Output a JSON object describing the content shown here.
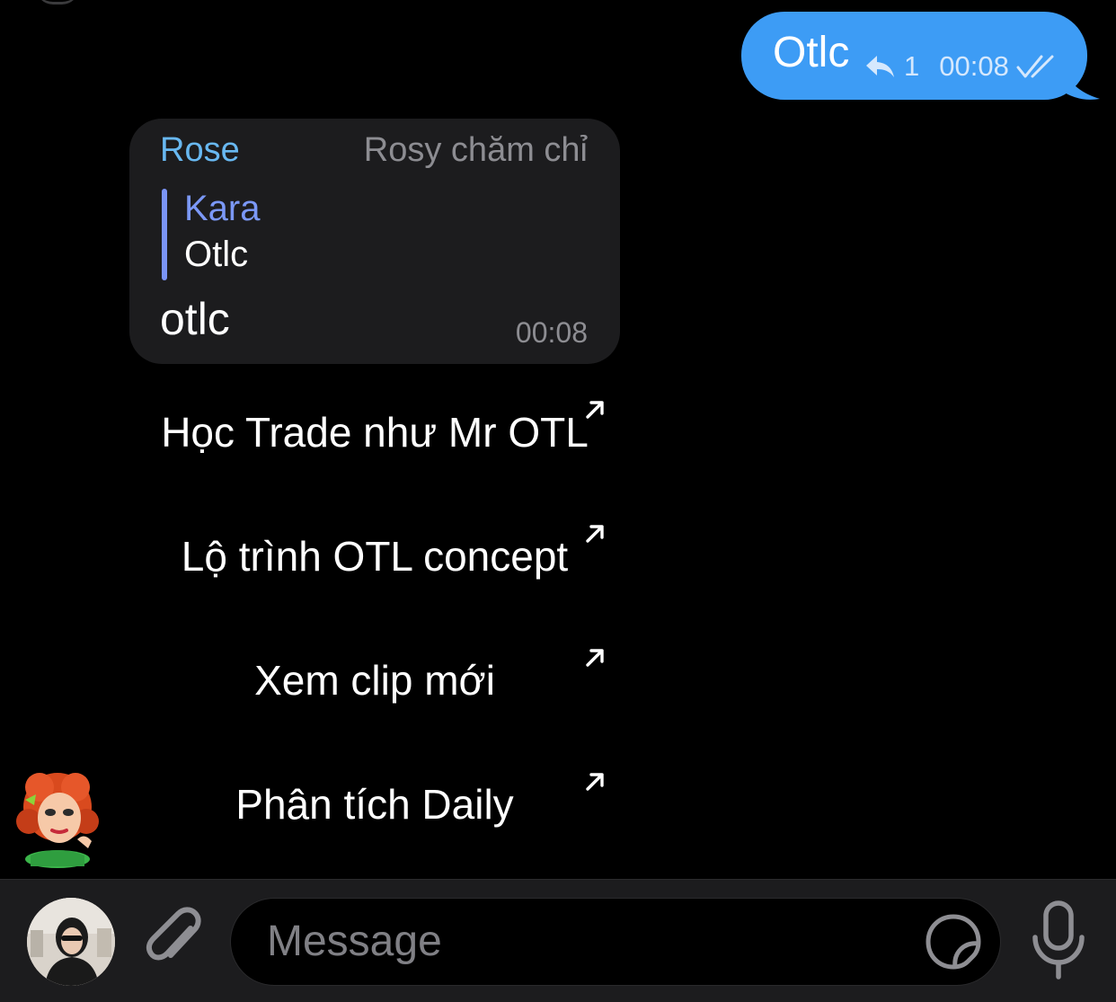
{
  "outgoing": {
    "text": "Otlc",
    "reply_count": "1",
    "time": "00:08",
    "status_icon": "double-check-icon"
  },
  "incoming": {
    "sender": "Rose",
    "sender_title": "Rosy chăm chỉ",
    "reply_to": {
      "name": "Kara",
      "text": "Otlc"
    },
    "text": "otlc",
    "time": "00:08"
  },
  "keyboard": [
    {
      "label": "Học Trade như Mr OTL",
      "icon": "external-link-arrow-icon"
    },
    {
      "label": "Lộ trình OTL concept",
      "icon": "external-link-arrow-icon"
    },
    {
      "label": "Xem clip mới",
      "icon": "external-link-arrow-icon"
    },
    {
      "label": "Phân tích Daily",
      "icon": "external-link-arrow-icon"
    }
  ],
  "input": {
    "placeholder": "Message",
    "icons": [
      "attach-icon",
      "sticker-icon",
      "mic-icon"
    ]
  },
  "colors": {
    "background": "#000000",
    "outgoing_bubble": "#3d9cf5",
    "incoming_bubble": "#1c1c1e",
    "sender_name": "#68b8f1",
    "reply_accent": "#7a94f6"
  }
}
